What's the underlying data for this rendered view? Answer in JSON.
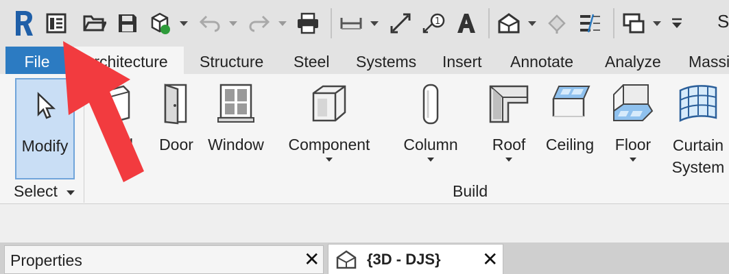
{
  "qat": {
    "tail_text": "S",
    "accent": "#2c7bc2"
  },
  "tabs": [
    {
      "label": "File"
    },
    {
      "label": "Architecture"
    },
    {
      "label": "Structure"
    },
    {
      "label": "Steel"
    },
    {
      "label": "Systems"
    },
    {
      "label": "Insert"
    },
    {
      "label": "Annotate"
    },
    {
      "label": "Analyze"
    },
    {
      "label": "Massi"
    }
  ],
  "ribbon": {
    "modify_label": "Modify",
    "select_label": "Select",
    "build_label": "Build",
    "tools": [
      {
        "label": "ll"
      },
      {
        "label": "Door"
      },
      {
        "label": "Window"
      },
      {
        "label": "Component"
      },
      {
        "label": "Column"
      },
      {
        "label": "Roof"
      },
      {
        "label": "Ceiling"
      },
      {
        "label": "Floor"
      },
      {
        "label": "Curtain System"
      }
    ]
  },
  "properties": {
    "title": "Properties"
  },
  "view_tab": {
    "title": "{3D - DJS}"
  },
  "annotation_color": "#f23b3f"
}
